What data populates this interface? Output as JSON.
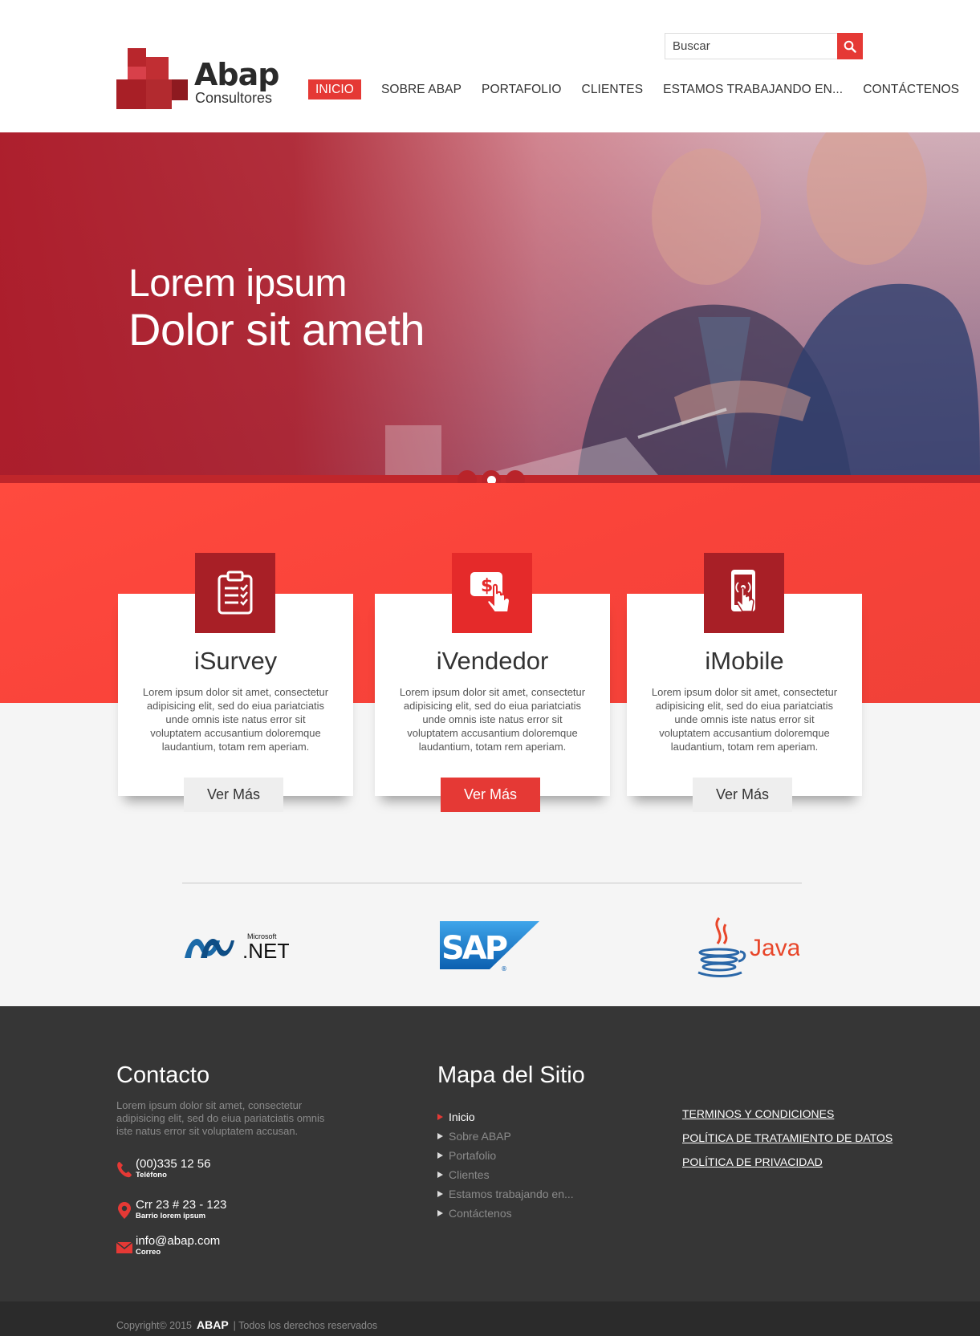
{
  "brand": {
    "name": "Abap",
    "tagline": "Consultores",
    "colors": {
      "accent": "#e53935",
      "dark": "#363636",
      "hero": "#ac1c2a"
    }
  },
  "search": {
    "placeholder": "Buscar"
  },
  "nav": [
    {
      "label": "INICIO",
      "active": true
    },
    {
      "label": "SOBRE ABAP"
    },
    {
      "label": "PORTAFOLIO"
    },
    {
      "label": "CLIENTES"
    },
    {
      "label": "ESTAMOS TRABAJANDO EN..."
    },
    {
      "label": "CONTÁCTENOS"
    }
  ],
  "hero": {
    "line1": "Lorem ipsum",
    "line2": "Dolor sit ameth",
    "slides": 3,
    "active_slide": 2
  },
  "features": [
    {
      "title": "iSurvey",
      "icon": "clipboard-checklist-icon",
      "text": "Lorem ipsum dolor sit amet, consectetur adipisicing elit, sed do eiua pariatciatis unde omnis iste natus error sit voluptatem accusantium doloremque laudantium, totam rem aperiam.",
      "button": "Ver Más"
    },
    {
      "title": "iVendedor",
      "icon": "dollar-tap-icon",
      "text": "Lorem ipsum dolor sit amet, consectetur adipisicing elit, sed do eiua pariatciatis unde omnis iste natus error sit voluptatem accusantium doloremque laudantium, totam rem aperiam.",
      "button": "Ver Más"
    },
    {
      "title": "iMobile",
      "icon": "mobile-touch-icon",
      "text": "Lorem ipsum dolor sit amet, consectetur adipisicing elit, sed do eiua pariatciatis unde omnis iste natus error sit voluptatem accusantium doloremque laudantium, totam rem aperiam.",
      "button": "Ver Más"
    }
  ],
  "partners": [
    {
      "name": "Microsoft",
      "label": ".NET"
    },
    {
      "name": "SAP"
    },
    {
      "name": "Java"
    }
  ],
  "footer": {
    "contact_title": "Contacto",
    "contact_text": "Lorem ipsum dolor sit amet, consectetur adipisicing elit, sed do eiua pariatciatis omnis iste natus error sit voluptatem accusan.",
    "phone": {
      "value": "(00)335 12 56",
      "label": "Teléfono"
    },
    "address": {
      "value": "Crr 23 # 23 - 123",
      "label": "Barrio lorem ipsum"
    },
    "email": {
      "value": "info@abap.com",
      "label": "Correo"
    },
    "sitemap_title": "Mapa del Sitio",
    "sitemap": [
      {
        "label": "Inicio",
        "active": true
      },
      {
        "label": "Sobre ABAP"
      },
      {
        "label": "Portafolio"
      },
      {
        "label": "Clientes"
      },
      {
        "label": "Estamos trabajando en..."
      },
      {
        "label": "Contáctenos"
      }
    ],
    "legal": [
      {
        "label": "TERMINOS Y CONDICIONES"
      },
      {
        "label": "POLÍTICA DE TRATAMIENTO DE DATOS"
      },
      {
        "label": "POLÍTICA DE PRIVACIDAD"
      }
    ],
    "copyright": {
      "prefix": "Copyright© 2015",
      "brand": "ABAP",
      "suffix": "| Todos los derechos reservados"
    }
  }
}
